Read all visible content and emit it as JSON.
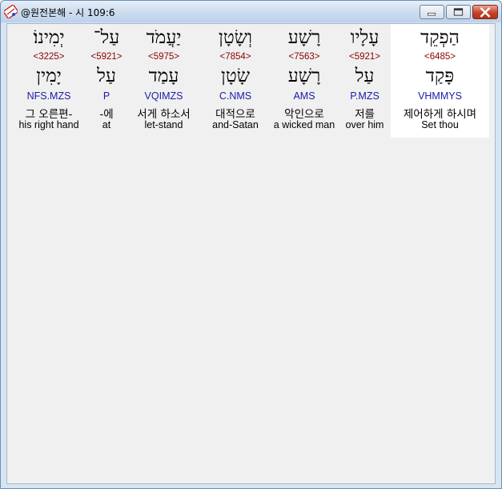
{
  "window": {
    "title": "@원전본해 - 시 109:6"
  },
  "words": [
    {
      "hebrew": "יְמִינוֹ׃",
      "strong": "<3225>",
      "root": "יָמִין",
      "parse": "NFS.MZS",
      "korean": "그 오른편-",
      "english": "his right hand"
    },
    {
      "hebrew": "עַל־",
      "strong": "<5921>",
      "root": "עַל",
      "parse": "P",
      "korean": "-에",
      "english": "at"
    },
    {
      "hebrew": "יַעֲמֹד",
      "strong": "<5975>",
      "root": "עָמַד",
      "parse": "VQIMZS",
      "korean": "서게 하소서",
      "english": "let-stand"
    },
    {
      "hebrew": "וְשָׂטָן",
      "strong": "<7854>",
      "root": "שָׂטָן",
      "parse": "C.NMS",
      "korean": "대적으로",
      "english": "and-Satan"
    },
    {
      "hebrew": "רָשָׁע",
      "strong": "<7563>",
      "root": "רָשָׁע",
      "parse": "AMS",
      "korean": "악인으로",
      "english": "a wicked man"
    },
    {
      "hebrew": "עָלָיו",
      "strong": "<5921>",
      "root": "עַל",
      "parse": "P.MZS",
      "korean": "저를",
      "english": "over him"
    },
    {
      "hebrew": "הַפְקֵד",
      "strong": "<6485>",
      "root": "פָּקַד",
      "parse": "VHMMYS",
      "korean": "제어하게 하시며",
      "english": "Set thou"
    }
  ],
  "icons": {
    "app": "bible-book-icon",
    "minimize": "minimize-icon",
    "maximize": "maximize-icon",
    "close": "close-icon"
  },
  "colors": {
    "strong": "#8b0000",
    "parse": "#1a1aaa",
    "selected_bg": "#ffffff"
  }
}
